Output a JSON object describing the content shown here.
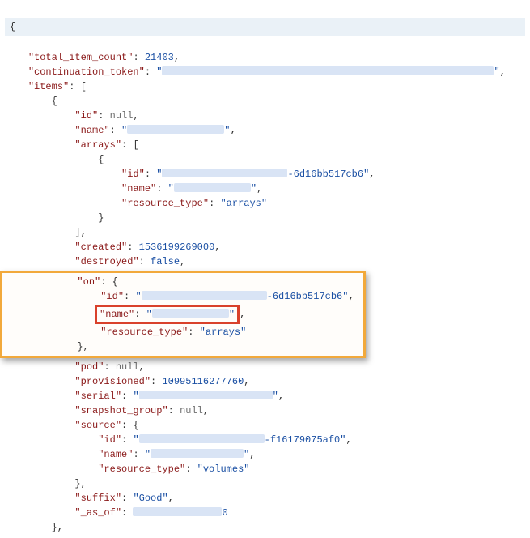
{
  "json": {
    "total_item_count_key": "total_item_count",
    "total_item_count_val": "21403",
    "continuation_token_key": "continuation_token",
    "items_key": "items",
    "item": {
      "id_key": "id",
      "id_val": "null",
      "name_key": "name",
      "arrays_key": "arrays",
      "arr_id_key": "id",
      "arr_id_suffix": "-6d16bb517cb6",
      "arr_name_key": "name",
      "arr_rtype_key": "resource_type",
      "arr_rtype_val": "arrays",
      "created_key": "created",
      "created_val": "1536199269000",
      "destroyed_key": "destroyed",
      "destroyed_val": "false",
      "on_key": "on",
      "on_id_key": "id",
      "on_id_suffix": "-6d16bb517cb6",
      "on_name_key": "name",
      "on_rtype_key": "resource_type",
      "on_rtype_val": "arrays",
      "pod_key": "pod",
      "pod_val": "null",
      "provisioned_key": "provisioned",
      "provisioned_val": "10995116277760",
      "serial_key": "serial",
      "snapshot_group_key": "snapshot_group",
      "snapshot_group_val": "null",
      "source_key": "source",
      "source_id_key": "id",
      "source_id_suffix": "-f16179075af0",
      "source_name_key": "name",
      "source_rtype_key": "resource_type",
      "source_rtype_val": "volumes",
      "suffix_key": "suffix",
      "suffix_val": "Good",
      "as_of_key": "_as_of",
      "as_of_val": "0"
    }
  }
}
